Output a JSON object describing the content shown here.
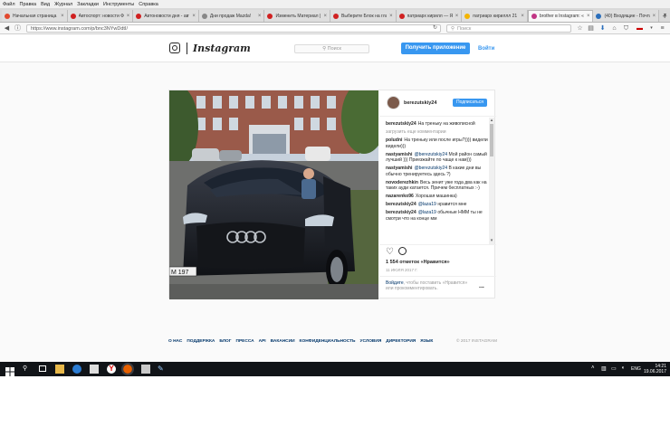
{
  "menu": [
    "Файл",
    "Правка",
    "Вид",
    "Журнал",
    "Закладки",
    "Инструменты",
    "Справка"
  ],
  "tabs": [
    {
      "title": "Начальная страница",
      "color": "#e2492f",
      "active": false
    },
    {
      "title": "Автоспорт: новости Ф",
      "color": "#d02020",
      "active": false
    },
    {
      "title": "Автоновости дня - авт",
      "color": "#d02020",
      "active": false
    },
    {
      "title": "Дни продаж Mazda!",
      "color": "#888888",
      "active": false
    },
    {
      "title": "Изменить Материал |",
      "color": "#d02020",
      "active": false
    },
    {
      "title": "Выберите Блок на глав",
      "color": "#d02020",
      "active": false
    },
    {
      "title": "патриарх кирилл — Я",
      "color": "#d02020",
      "active": false
    },
    {
      "title": "патриарх кириллл 21",
      "color": "#f4b400",
      "active": false
    },
    {
      "title": "brother в Instagram: «Н",
      "color": "#c13584",
      "active": true
    },
    {
      "title": "(40) Входящие - Почта",
      "color": "#2a6ebb",
      "active": false
    }
  ],
  "nav": {
    "url": "https://www.instagram.com/p/bnc3NYwDdtI/",
    "search_placeholder": "Поиск"
  },
  "instagram": {
    "logo_text": "Instagram",
    "search_placeholder": "Поиск",
    "get_app_label": "Получить приложение",
    "login_label": "Войти"
  },
  "post": {
    "author": "berezutskiy24",
    "follow_label": "Подписаться",
    "caption_user": "berezutskiy24",
    "caption_text": "На треньку на живописной",
    "load_more": "загрузить еще комментарии",
    "comments": [
      {
        "user": "poludni",
        "mention": "",
        "text": "На треньку или после игры?)))) видели видели)))"
      },
      {
        "user": "nastyamishi",
        "mention": "@berezutskiy24",
        "text": "Мой район самый лучший ))) Приезжайте по чаще к нам)))"
      },
      {
        "user": "nastyamishi",
        "mention": "@berezutskiy24",
        "text": "В какие дни вы обычно тренируетесь здесь ?)"
      },
      {
        "user": "novoderezhkin",
        "mention": "",
        "text": "Весь зенит уже года два как на таких ауди катается. Причем бесплатных :-)"
      },
      {
        "user": "nazarenko96",
        "mention": "",
        "text": "Хорошая машинка)"
      },
      {
        "user": "berezutskiy24",
        "mention": "@laza19",
        "text": "нравится мне"
      },
      {
        "user": "berezutskiy24",
        "mention": "@laza19",
        "text": "обычные НММ ты не смотри что на конце мм"
      }
    ],
    "likes": "1 554 отметок «Нравится»",
    "date": "11 ИЮЛЯ 2017 Г.",
    "login_link": "Войдите",
    "login_rest": ", чтобы поставить «Нравится» или прокомментировать.",
    "more_label": "..."
  },
  "photo": {
    "plate": "М 197"
  },
  "footer": {
    "links": [
      "О НАС",
      "ПОДДЕРЖКА",
      "БЛОГ",
      "ПРЕССА",
      "API",
      "ВАКАНСИИ",
      "КОНФИДЕНЦИАЛЬНОСТЬ",
      "УСЛОВИЯ",
      "ДИРЕКТОРИЯ",
      "ЯЗЫК"
    ],
    "copyright": "© 2017 INSTAGRAM"
  },
  "taskbar": {
    "lang": "ENG",
    "time": "14:21",
    "date": "19.06.2017"
  }
}
